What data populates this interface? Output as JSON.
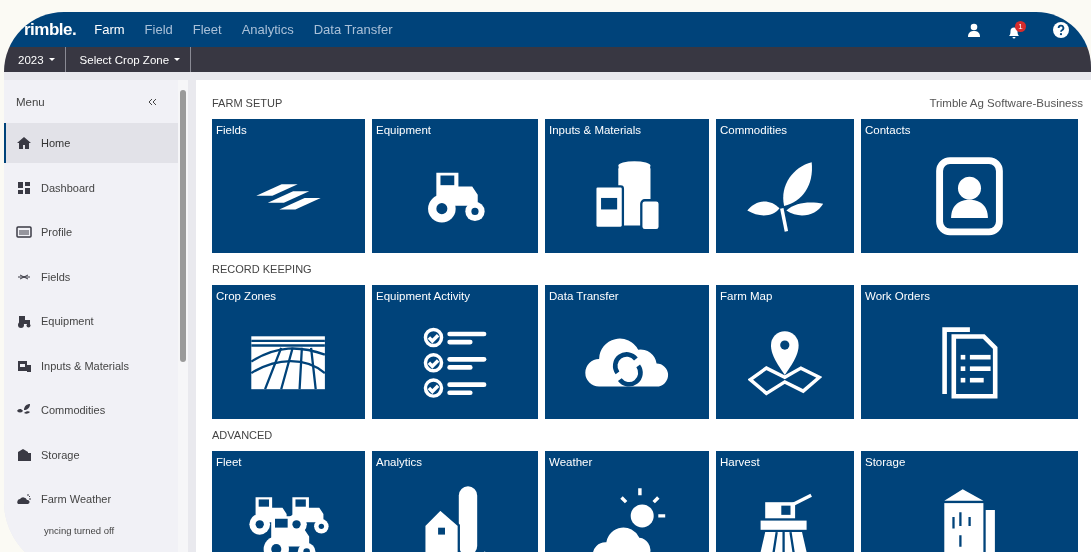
{
  "top_bar": {
    "logo": "rimble.",
    "nav": [
      {
        "label": "Farm",
        "selected": true
      },
      {
        "label": "Field",
        "selected": false
      },
      {
        "label": "Fleet",
        "selected": false
      },
      {
        "label": "Analytics",
        "selected": false
      },
      {
        "label": "Data Transfer",
        "selected": false
      }
    ],
    "notification_badge": "1"
  },
  "sub_bar": {
    "dropdowns": [
      "2023",
      "Select Crop Zone"
    ]
  },
  "sidebar": {
    "title": "Menu",
    "items": [
      {
        "label": "Home",
        "selected": true
      },
      {
        "label": "Dashboard",
        "selected": false
      },
      {
        "label": "Profile",
        "selected": false
      },
      {
        "label": "Fields",
        "selected": false
      },
      {
        "label": "Equipment",
        "selected": false
      },
      {
        "label": "Inputs & Materials",
        "selected": false
      },
      {
        "label": "Commodities",
        "selected": false
      },
      {
        "label": "Storage",
        "selected": false
      },
      {
        "label": "Farm Weather",
        "selected": false
      }
    ],
    "footer": "yncing turned off"
  },
  "main": {
    "org_name": "Trimble Ag Software-Business",
    "sections": [
      {
        "title": "FARM SETUP",
        "tiles": [
          "Fields",
          "Equipment",
          "Inputs & Materials",
          "Commodities",
          "Contacts"
        ]
      },
      {
        "title": "RECORD KEEPING",
        "tiles": [
          "Crop Zones",
          "Equipment Activity",
          "Data Transfer",
          "Farm Map",
          "Work Orders"
        ]
      },
      {
        "title": "ADVANCED",
        "tiles": [
          "Fleet",
          "Analytics",
          "Weather",
          "Harvest",
          "Storage"
        ]
      }
    ]
  }
}
